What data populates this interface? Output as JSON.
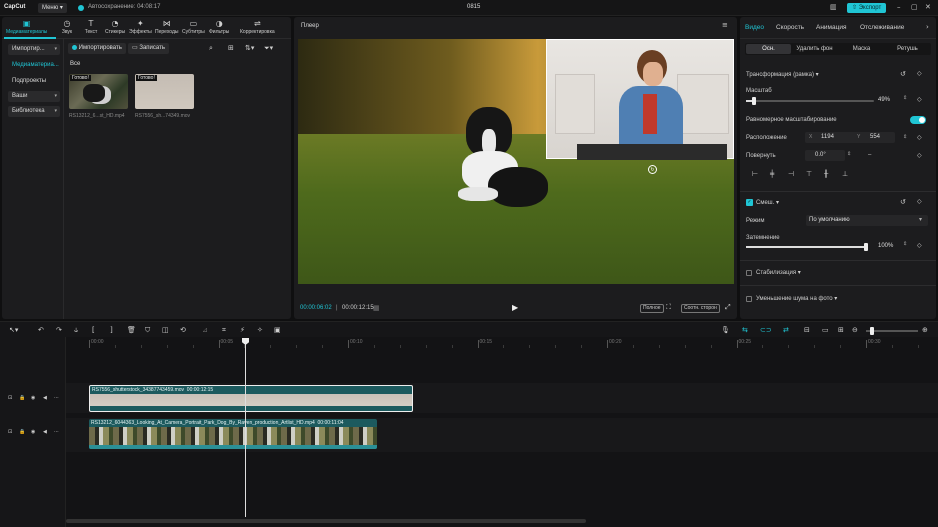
{
  "titlebar": {
    "logo": "CapCut",
    "menu_label": "Меню",
    "autosave": "Автосохранение: 04:08:17",
    "project_name": "0815",
    "export_label": "Экспорт"
  },
  "toolbar": {
    "tabs": [
      {
        "label": "Медиаматериалы",
        "icon": "media-icon",
        "glyph": "▣"
      },
      {
        "label": "Звук",
        "icon": "audio-icon",
        "glyph": "◷"
      },
      {
        "label": "Текст",
        "icon": "text-icon",
        "glyph": "T"
      },
      {
        "label": "Стикеры",
        "icon": "sticker-icon",
        "glyph": "◔"
      },
      {
        "label": "Эффекты",
        "icon": "effects-icon",
        "glyph": "✦"
      },
      {
        "label": "Переходы",
        "icon": "transitions-icon",
        "glyph": "⋈"
      },
      {
        "label": "Субтитры",
        "icon": "subtitles-icon",
        "glyph": "▭"
      },
      {
        "label": "Фильтры",
        "icon": "filters-icon",
        "glyph": "◑"
      },
      {
        "label": "Корректировка",
        "icon": "adjust-icon",
        "glyph": "⇌"
      }
    ]
  },
  "media_sidebar": {
    "items": [
      {
        "label": "Импортир...",
        "chevron": "▾"
      },
      {
        "label": "Медиаматериа...",
        "chevron": ""
      },
      {
        "label": "Подпроекты",
        "chevron": ""
      },
      {
        "label": "Ваши",
        "chevron": "▾"
      },
      {
        "label": "Библиотека",
        "chevron": "▾"
      }
    ]
  },
  "media": {
    "import_label": "Импортировать",
    "record_label": "Записать",
    "filter_all": "Все",
    "items": [
      {
        "badge": "Готово!",
        "name": "RS13212_6...st_HD.mp4"
      },
      {
        "badge": "Готово!",
        "name": "RS7556_sh...74349.mov"
      }
    ]
  },
  "player": {
    "title": "Плеер",
    "current_time": "00:00:06:02",
    "total_time": "00:00:12:15",
    "full_label": "Полное",
    "ratio_label": "Соотн. сторон"
  },
  "inspector": {
    "tabs": [
      "Видео",
      "Скорость",
      "Анимация",
      "Отслеживание"
    ],
    "subtabs": [
      "Осн.",
      "Удалить фон",
      "Маска",
      "Ретушь"
    ],
    "transform_label": "Трансформация (рамка)",
    "scale_label": "Масштаб",
    "scale_value": "49%",
    "scale_fraction": 0.06,
    "uniform_label": "Равномерное масштабирование",
    "position_label": "Расположение",
    "pos_x_label": "X",
    "pos_x": "1194",
    "pos_y_label": "Y",
    "pos_y": "554",
    "rotate_label": "Повернуть",
    "rotate_value": "0.0°",
    "rotate_dash": "–",
    "blend_label": "Смеш.",
    "mode_label": "Режим",
    "mode_value": "По умолчанию",
    "opacity_label": "Затемнение",
    "opacity_value": "100%",
    "opacity_fraction": 1.0,
    "stabilize_label": "Стабилизация",
    "denoise_label": "Уменьшение шума на фото"
  },
  "timeline": {
    "ticks": [
      "00:00",
      "00:05",
      "00:10",
      "00:15",
      "00:20",
      "00:25",
      "00:30"
    ],
    "overlay_clip": {
      "name": "RS7556_shutterstock_34387743459.mov",
      "duration": "00:00:12:15"
    },
    "main_clip": {
      "name": "RS13212_6044363_Looking_At_Camera_Portrait_Park_Dog_By_Raven_production_Artlist_HD.mp4",
      "duration": "00:00:11:04"
    }
  },
  "colors": {
    "accent": "#20c5d4",
    "clip_teal": "#1c5a5e"
  }
}
